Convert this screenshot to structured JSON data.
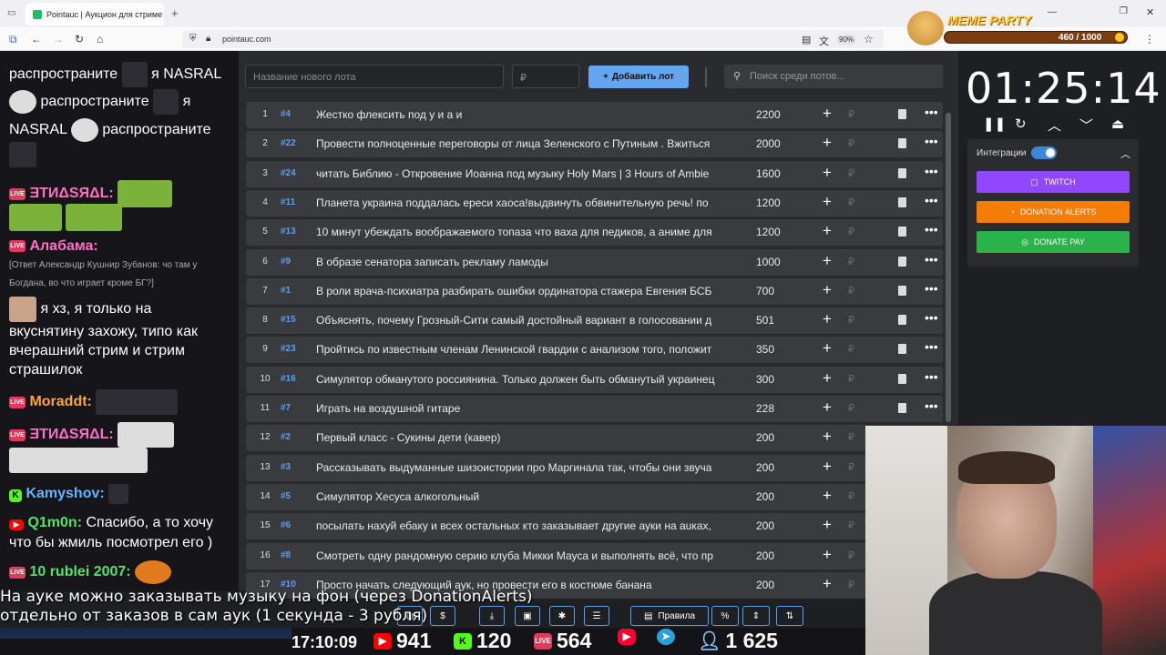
{
  "browser": {
    "tab_title": "Pointauc | Аукцион для стриме",
    "tab_close": "✕",
    "new_tab": "+",
    "url": "pointauc.com",
    "zoom": "90%"
  },
  "meme_party": {
    "title": "MEME PARTY",
    "progress_label": "460 / 1000",
    "progress_fraction": 0.46
  },
  "chat": {
    "lines": [
      "распространите",
      "я NASRAL",
      "распространите",
      "я",
      "NASRAL",
      "распространите",
      "ƎTИΔSЯΔL:",
      "Алабама:",
      "[Ответ Александр Кушнир Зубанов: чо там у",
      "Богдана, во что играет кроме БГ?]",
      "я хз, я только на",
      "вкуснятину захожу, типо как",
      "вчерашний стрим и стрим",
      "страшилок",
      "Moraddt:",
      "ƎTИΔSЯΔL:",
      "Kamyshov:",
      "Q1m0n:",
      "Спасибо, а то хочу",
      "что бы жмиль посмотрел его )",
      "10 rublei 2007:"
    ]
  },
  "lots_panel": {
    "new_lot_placeholder": "Название нового лота",
    "amount_placeholder": "₽",
    "add_button": "Добавить лот",
    "search_placeholder": "Поиск среди потов...",
    "lots": [
      {
        "num": "1",
        "id": "#4",
        "name": "Жестко флексить под у и а и",
        "amount": "2200"
      },
      {
        "num": "2",
        "id": "#22",
        "name": "Провести полноценные переговоры от лица Зеленского с Путиным . Вжиться",
        "amount": "2000"
      },
      {
        "num": "3",
        "id": "#24",
        "name": "читать Библию - Откровение Иоанна под музыку Holy Mars | 3 Hours of Ambie",
        "amount": "1600"
      },
      {
        "num": "4",
        "id": "#11",
        "name": "Планета украина поддалась ереси хаоса!выдвинуть обвинительную речь! по",
        "amount": "1200"
      },
      {
        "num": "5",
        "id": "#13",
        "name": "10 минут убеждать воображаемого топаза что ваха для педиков, а аниме для",
        "amount": "1200"
      },
      {
        "num": "6",
        "id": "#9",
        "name": "В образе сенатора записать рекламу ламоды",
        "amount": "1000"
      },
      {
        "num": "7",
        "id": "#1",
        "name": "В роли врача-психиатра разбирать ошибки ординатора стажера Евгения БСБ",
        "amount": "700"
      },
      {
        "num": "8",
        "id": "#15",
        "name": "Объяснять, почему Грозный-Сити самый достойный вариант в голосовании д",
        "amount": "501"
      },
      {
        "num": "9",
        "id": "#23",
        "name": "Пройтись по известным членам Ленинской гвардии с анализом того, положит",
        "amount": "350"
      },
      {
        "num": "10",
        "id": "#16",
        "name": "Симулятор обманутого россиянина. Только должен быть обманутый украинец",
        "amount": "300"
      },
      {
        "num": "11",
        "id": "#7",
        "name": "Играть на воздушной гитаре",
        "amount": "228"
      },
      {
        "num": "12",
        "id": "#2",
        "name": "Первый класс - Сукины дети (кавер)",
        "amount": "200"
      },
      {
        "num": "13",
        "id": "#3",
        "name": "Рассказывать выдуманные шизоистории про Маргинала так, чтобы они звуча",
        "amount": "200"
      },
      {
        "num": "14",
        "id": "#5",
        "name": "Симулятор Хесуса алкогольный",
        "amount": "200"
      },
      {
        "num": "15",
        "id": "#6",
        "name": "посылать нахуй ебаку и всех остальных кто заказывает другие ауки на auках,",
        "amount": "200"
      },
      {
        "num": "16",
        "id": "#8",
        "name": "Смотреть одну рандомную серию клуба Микки Мауса и выполнять всё, что пр",
        "amount": "200"
      },
      {
        "num": "17",
        "id": "#10",
        "name": "Просто начать следующий аук, но провести его в костюме банана",
        "amount": "200"
      }
    ],
    "currency_symbol": "₽"
  },
  "toolbar": {
    "rules_label": "Правила",
    "percent_label": "%"
  },
  "timer": {
    "value": "01:25:14"
  },
  "integrations": {
    "label": "Интеграции",
    "twitch": "TWITCH",
    "donation_alerts": "DONATION ALERTS",
    "donate_pay": "DONATE PAY",
    "colors": {
      "twitch": "#9146ff",
      "donation_alerts": "#f57d07",
      "donate_pay": "#2ab24b"
    }
  },
  "overlay": {
    "subtitle_line1": "На ауке можно заказывать музыку на фон (через DonationAlerts)",
    "subtitle_line2": "отдельно от заказов в сам аук (1 секунда - 3 рубля)",
    "clock": "17:10:09",
    "youtube_count": "941",
    "kick_count": "120",
    "live_count": "564",
    "total_viewers": "1 625"
  }
}
